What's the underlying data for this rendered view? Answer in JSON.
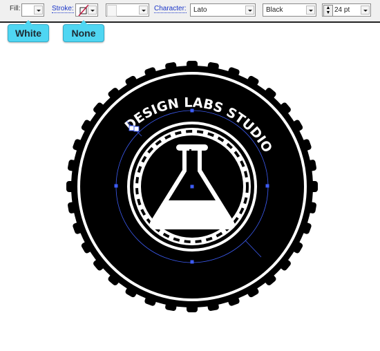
{
  "toolbar": {
    "fill_label": "Fill:",
    "stroke_label": "Stroke:",
    "character_label": "Character:",
    "font_family": "Lato",
    "font_style": "Black",
    "font_size": "24 pt"
  },
  "callouts": {
    "fill": "White",
    "stroke": "None"
  },
  "badge": {
    "text": "DESIGN LABS STUDIO",
    "selection_color": "#3d5cf5",
    "callout_color": "#4fd6f2"
  }
}
